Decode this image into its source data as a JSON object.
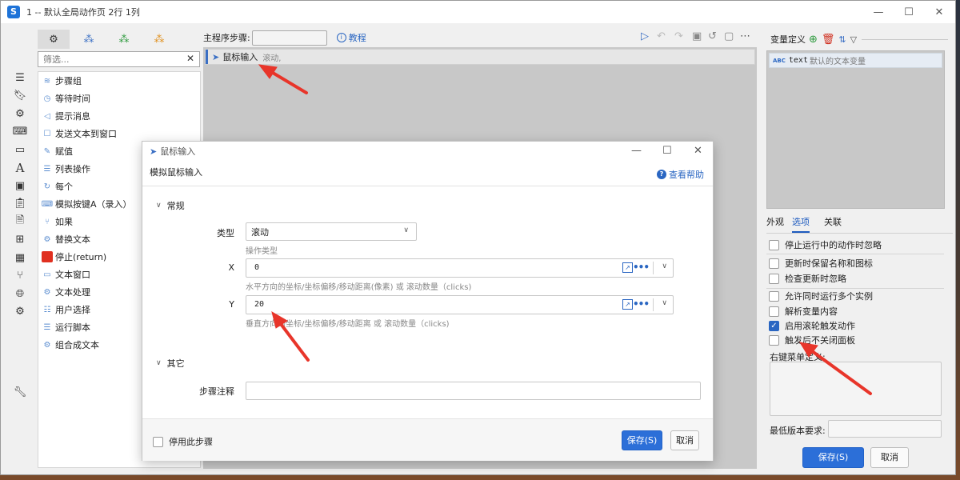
{
  "window": {
    "title": "1 -- 默认全局动作页 2行 1列",
    "app_icon": "S",
    "controls": [
      "—",
      "☐",
      "✕"
    ]
  },
  "left_rail": {
    "icons": [
      "hamburger-menu-icon",
      "bookmark-icon",
      "gear-icon",
      "keyboard-icon",
      "window-icon",
      "font-icon",
      "image-icon",
      "clipboard-icon",
      "document-icon",
      "windows-icon",
      "grid-icon",
      "branch-icon",
      "globe-icon",
      "settings-cluster-icon",
      "wrench-icon"
    ]
  },
  "palette": {
    "tabs": [
      "gear-cluster-icon",
      "triple-blue-icon",
      "triple-green-icon",
      "triple-orange-icon"
    ],
    "filter_placeholder": "筛选...",
    "items": [
      {
        "label": "步骤组",
        "icon": "layers-icon"
      },
      {
        "label": "等待时间",
        "icon": "clock-icon"
      },
      {
        "label": "提示消息",
        "icon": "megaphone-icon"
      },
      {
        "label": "发送文本到窗口",
        "icon": "chat-icon"
      },
      {
        "label": "赋值",
        "icon": "edit-icon"
      },
      {
        "label": "列表操作",
        "icon": "list-icon"
      },
      {
        "label": "每个",
        "icon": "loop-icon"
      },
      {
        "label": "模拟按键A（录入）",
        "icon": "keyboard-icon"
      },
      {
        "label": "如果",
        "icon": "branch-icon"
      },
      {
        "label": "替换文本",
        "icon": "gear-icon"
      },
      {
        "label": "停止(return)",
        "icon": "stop-icon"
      },
      {
        "label": "文本窗口",
        "icon": "window-icon"
      },
      {
        "label": "文本处理",
        "icon": "gear-icon"
      },
      {
        "label": "用户选择",
        "icon": "list-select-icon"
      },
      {
        "label": "运行脚本",
        "icon": "script-icon"
      },
      {
        "label": "组合成文本",
        "icon": "gear-icon"
      }
    ]
  },
  "main": {
    "steps_label": "主程序步骤:",
    "tutorial_label": "教程",
    "step_row": {
      "name": "鼠标输入",
      "detail": "滚动,"
    }
  },
  "variables": {
    "title": "变量定义",
    "row": {
      "type": "ABC",
      "name": "text",
      "desc": "默认的文本变量"
    }
  },
  "right_tabs": [
    "外观",
    "选项",
    "关联"
  ],
  "options": [
    {
      "label": "停止运行中的动作时忽略",
      "checked": false
    },
    {
      "label": "更新时保留名称和图标",
      "checked": false
    },
    {
      "label": "检查更新时忽略",
      "checked": false
    },
    {
      "label": "允许同时运行多个实例",
      "checked": false
    },
    {
      "label": "解析变量内容",
      "checked": false
    },
    {
      "label": "启用滚轮触发动作",
      "checked": true
    },
    {
      "label": "触发后不关闭面板",
      "checked": false
    }
  ],
  "context_menu_label": "右键菜单定义:",
  "min_version_label": "最低版本要求:",
  "save_label": "保存(S)",
  "cancel_label": "取消",
  "dialog": {
    "title": "鼠标输入",
    "subtitle": "模拟鼠标输入",
    "help": "查看帮助",
    "section_general": "常规",
    "section_other": "其它",
    "type_label": "类型",
    "type_value": "滚动",
    "type_hint": "操作类型",
    "x_label": "X",
    "x_value": "0",
    "x_hint": "水平方向的坐标/坐标偏移/移动距离(像素) 或 滚动数量（clicks)",
    "y_label": "Y",
    "y_value": "20",
    "y_hint": "垂直方向的坐标/坐标偏移/移动距离 或 滚动数量（clicks)",
    "note_label": "步骤注释",
    "disable_label": "停用此步骤",
    "save": "保存(S)",
    "cancel": "取消"
  },
  "colors": {
    "accent": "#2c6fd8",
    "arrow": "#e8352a",
    "stop": "#e03020"
  }
}
